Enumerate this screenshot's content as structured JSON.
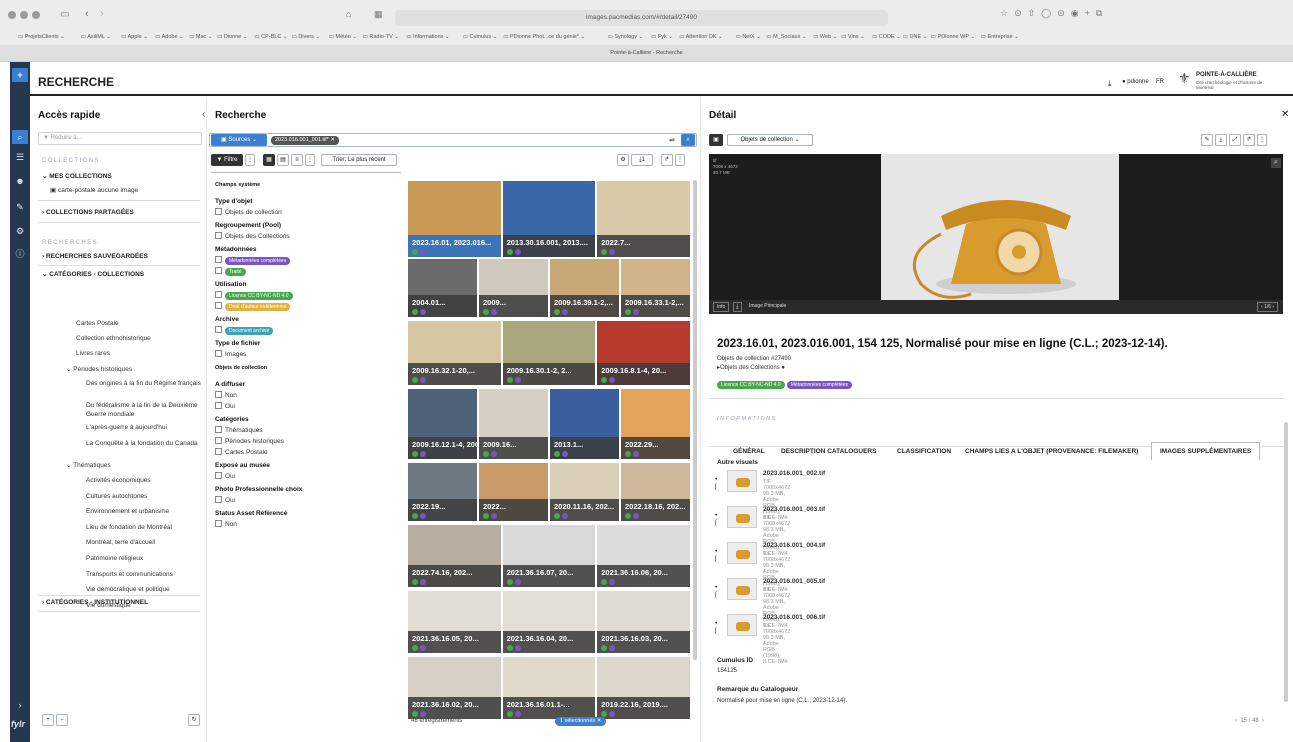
{
  "browser": {
    "url": "images.pacmedias.com/#/detail/27490",
    "tab_title": "Pointe-à-Callière - Recherche",
    "bookmarks": [
      "ProjetsClients",
      "AsiliML",
      "Apple",
      "Adobe",
      "Mac",
      "Dionne",
      "CP-BLC",
      "Divers",
      "Météo",
      "Radio-TV",
      "Informations",
      "Cumulus",
      "PDionne Phot...ce du génie*",
      "Synology",
      "Fyk",
      "Attention DK",
      "NetX",
      "M_Sociaux",
      "Web",
      "Vins",
      "CODE",
      "DNE",
      "PDionne WP",
      "Entreprise"
    ]
  },
  "app": {
    "section_title": "RECHERCHE",
    "user": "pdionne",
    "lang": "FR",
    "brand": "POINTE-À-CALLIÈRE",
    "brand_sub": "Cité d'archéologie et d'histoire de Montréal",
    "footer_logo": "fylr"
  },
  "quick": {
    "title": "Accès rapide",
    "search_placeholder": "Réduire à...",
    "collections_header": "COLLECTIONS",
    "my_collections": "MES COLLECTIONS",
    "postcard": "carte-postale aucune image",
    "shared": "COLLECTIONS PARTAGÉES",
    "searches_header": "RECHERCHES",
    "saved": "RECHERCHES SAUVEGARDÉES",
    "cat_collections": "CATÉGORIES - COLLECTIONS",
    "items": [
      "Cartes Postale",
      "Collection ethnohistorique",
      "Livres rares"
    ],
    "periods": "Périodes historiques",
    "period_items": [
      "Des origines à la fin du Régime français",
      "Du fédéralisme à la fin de la Deuxième Guerre mondiale",
      "L'après-guerre à aujourd'hui",
      "La Conquête à la fondation du Canada"
    ],
    "themes": "Thématiques",
    "theme_items": [
      "Activités économiques",
      "Cultures autochtones",
      "Environnement et urbanisme",
      "Lieu de fondation de Montréal",
      "Montréal, terre d'accueil",
      "Patrimoine religieux",
      "Transports et communications",
      "Vie démocratique et politique",
      "Vie domestique"
    ],
    "cat_inst": "CATÉGORIES - INSTITUTIONNEL"
  },
  "search": {
    "title": "Recherche",
    "sources": "Sources",
    "token": "2023.016.001_001.tif*",
    "filter": "Filtre",
    "sort": "Trier: Le plus récent",
    "download_count": "1",
    "footer_count": "48 enregistrements",
    "footer_selected": "1 sélectionnés"
  },
  "filters": [
    {
      "t": "Champs système",
      "kind": "head"
    },
    {
      "t": "Type d'objet",
      "kind": "b"
    },
    {
      "t": "Objets de collection",
      "kind": "cb"
    },
    {
      "t": "Regroupement (Pool)",
      "kind": "b"
    },
    {
      "t": "Objets des Collections",
      "kind": "cb"
    },
    {
      "t": "Métadonnées",
      "kind": "b"
    },
    {
      "t": "Métadonnées complétées",
      "kind": "pill",
      "c": "#7a55c2"
    },
    {
      "t": "Traité",
      "kind": "pill",
      "c": "#46a84a"
    },
    {
      "t": "Utilisation",
      "kind": "b"
    },
    {
      "t": "Licence CC BY-NC-ND 4.0",
      "kind": "pill",
      "c": "#46a84a"
    },
    {
      "t": "Droit d'auteur indéterminé",
      "kind": "pill",
      "c": "#e2b23c"
    },
    {
      "t": "Archive",
      "kind": "b"
    },
    {
      "t": "Document archivé",
      "kind": "pill",
      "c": "#3fa0b7"
    },
    {
      "t": "Type de fichier",
      "kind": "b"
    },
    {
      "t": "Images",
      "kind": "cb"
    },
    {
      "t": "Objets de collection",
      "kind": "head"
    },
    {
      "t": "A diffuser",
      "kind": "b"
    },
    {
      "t": "Non",
      "kind": "cb"
    },
    {
      "t": "Oui",
      "kind": "cb"
    },
    {
      "t": "Catégories",
      "kind": "b"
    },
    {
      "t": "Thématiques",
      "kind": "cb"
    },
    {
      "t": "Périodes historiques",
      "kind": "cb"
    },
    {
      "t": "Cartes Postale",
      "kind": "cb"
    },
    {
      "t": "Exposé au musée",
      "kind": "b"
    },
    {
      "t": "Oui",
      "kind": "cb"
    },
    {
      "t": "Photo Professionnelle choix",
      "kind": "b"
    },
    {
      "t": "Oui",
      "kind": "cb"
    },
    {
      "t": "Status Asset Référencé",
      "kind": "b"
    },
    {
      "t": "Non",
      "kind": "cb"
    }
  ],
  "results": [
    {
      "label": "2023.16.01, 2023.016...",
      "bg": "#c89a55",
      "sel": true,
      "row": 0,
      "col": 0
    },
    {
      "label": "2013.30.16.001, 2013....",
      "bg": "#3a67a8",
      "row": 0,
      "col": 1
    },
    {
      "label": "2022.7...",
      "bg": "#d8c9a8",
      "row": 0,
      "col": 2
    },
    {
      "label": "2004.01...",
      "bg": "#6b6b6b",
      "row": 1,
      "col": 0
    },
    {
      "label": "2009...",
      "bg": "#cfc8bc",
      "row": 1,
      "col": 1
    },
    {
      "label": "2009.16.39.1-2,...",
      "bg": "#c9a877",
      "row": 1,
      "col": 2
    },
    {
      "label": "2009.16.33.1-2,...",
      "bg": "#d2b48a",
      "row": 1,
      "col": 3
    },
    {
      "label": "2009.16.32.1-20,...",
      "bg": "#d5c7a2",
      "row": 2,
      "col": 0
    },
    {
      "label": "2009.16.30.1-2, 2...",
      "bg": "#a9a67c",
      "row": 2,
      "col": 1
    },
    {
      "label": "2009.16.8.1-4, 20...",
      "bg": "#b63a2e",
      "row": 2,
      "col": 2
    },
    {
      "label": "2009.16.12.1-4, 2009...",
      "bg": "#50627a",
      "row": 3,
      "col": 0
    },
    {
      "label": "2009.16...",
      "bg": "#d6d0c4",
      "row": 3,
      "col": 1
    },
    {
      "label": "2013.1...",
      "bg": "#395f9e",
      "row": 3,
      "col": 2
    },
    {
      "label": "2022.29...",
      "bg": "#e4a25a",
      "row": 3,
      "col": 3
    },
    {
      "label": "2022.19...",
      "bg": "#6d7a82",
      "row": 4,
      "col": 0
    },
    {
      "label": "2022...",
      "bg": "#c89a6a",
      "row": 4,
      "col": 1
    },
    {
      "label": "2020.11.16, 202...",
      "bg": "#d9cfb8",
      "row": 4,
      "col": 2
    },
    {
      "label": "2022.18.16, 202...",
      "bg": "#cdb89a",
      "row": 4,
      "col": 3
    },
    {
      "label": "2022.74.16, 202...",
      "bg": "#b7ad9e",
      "row": 5,
      "col": 0
    },
    {
      "label": "2021.36.16.07, 20...",
      "bg": "#d8d8d8",
      "row": 5,
      "col": 1
    },
    {
      "label": "2021.36.16.06, 20...",
      "bg": "#dcdcdc",
      "row": 5,
      "col": 2
    },
    {
      "label": "2021.36.16.05, 20...",
      "bg": "#e0dcd6",
      "row": 6,
      "col": 0
    },
    {
      "label": "2021.36.16.04, 20...",
      "bg": "#e2ddd5",
      "row": 6,
      "col": 1
    },
    {
      "label": "2021.36.16.03, 20...",
      "bg": "#dedad4",
      "row": 6,
      "col": 2
    },
    {
      "label": "2021.36.16.02, 20...",
      "bg": "#d6d0c6",
      "row": 7,
      "col": 0
    },
    {
      "label": "2021.36.16.01.1-...",
      "bg": "#e0d8c8",
      "row": 7,
      "col": 1
    },
    {
      "label": "2019.22.16, 2019....",
      "bg": "#dcd6cc",
      "row": 7,
      "col": 2
    }
  ],
  "detail": {
    "title": "Détail",
    "type_select": "Objets de collection",
    "image_meta": [
      "tif",
      "7008 x 4672",
      "93.7 MB"
    ],
    "info_btn": "Info",
    "image_label": "Image Principale",
    "pager": "1/6",
    "heading": "2023.16.01, 2023.016.001, 154 125, Normalisé pour mise en ligne (C.L.; 2023-12-14).",
    "sub1": "Objets de collection #27490",
    "sub2": "Objets des Collections",
    "badge1": "Licence CC BY-NC-ND 4.0",
    "badge2": "Métadonnées complétées",
    "info_header": "INFORMATIONS",
    "tabs": [
      "GÉNÉRAL",
      "DESCRIPTION CATALOGUERS",
      "CLASSIFICATION",
      "CHAMPS LIES A L'OBJET (PROVENANCE: FILEMAKER)",
      "IMAGES SUPPLÉMENTAIRES"
    ],
    "autres": "Autre visuels",
    "supp": [
      {
        "name": "2023.016.001_002.tif",
        "meta": "TIF 7008x4672 98.3 MB, Adobe RGB (1998), ILCE-7M4"
      },
      {
        "name": "2023.016.001_003.tif",
        "meta": "TIF 7008x4672 98.3 MB, Adobe RGB (1998), ILCE-7M4"
      },
      {
        "name": "2023.016.001_004.tif",
        "meta": "TIF 7008x4672 98.3 MB, Adobe RGB (1998), ILCE-7M4"
      },
      {
        "name": "2023.016.001_005.tif",
        "meta": "TIF 7008x4672 98.3 MB, Adobe RGB (1998), ILCE-7M4"
      },
      {
        "name": "2023.016.001_006.tif",
        "meta": "TIF 7008x4672 98.3 MB, Adobe RGB (1998), ILCE-7M4"
      }
    ],
    "cumulus_label": "Cumulus ID",
    "cumulus_val": "154125",
    "remarque_label": "Remarque du Catalogueur",
    "remarque_val": "Normalisé pour mise en ligne (C.L.; 2023-12-14).",
    "footer_pager": "15 / 48"
  }
}
